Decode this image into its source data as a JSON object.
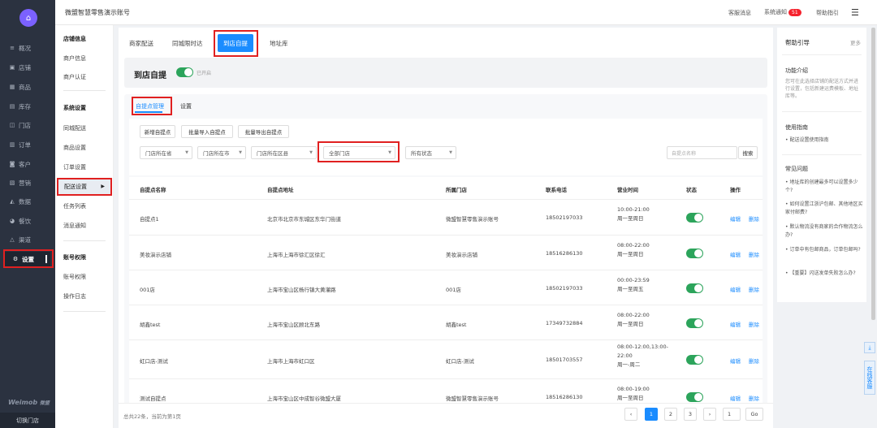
{
  "app": {
    "account_name": "微盟智慧零售演示账号",
    "brand": "Weimob",
    "brand_suffix": "微盟",
    "switch_store": "切换门店"
  },
  "topbar": {
    "service_msg": "客服消息",
    "sys_notice": "系统通知",
    "notice_count": "51",
    "help_guide": "帮助指引"
  },
  "leftnav": {
    "items": [
      {
        "label": "概况",
        "icon": "≡"
      },
      {
        "label": "店铺",
        "icon": "▣"
      },
      {
        "label": "商品",
        "icon": "▦"
      },
      {
        "label": "库存",
        "icon": "▤"
      },
      {
        "label": "门店",
        "icon": "◫"
      },
      {
        "label": "订单",
        "icon": "▥"
      },
      {
        "label": "客户",
        "icon": "◙"
      },
      {
        "label": "营销",
        "icon": "▧"
      },
      {
        "label": "数据",
        "icon": "◭"
      },
      {
        "label": "餐饮",
        "icon": "◕"
      },
      {
        "label": "渠道",
        "icon": "△"
      },
      {
        "label": "设置",
        "icon": "⚙"
      }
    ]
  },
  "subnav": {
    "store_info": "店铺信息",
    "merchant_info": "商户信息",
    "merchant_auth": "商户认证",
    "sys_settings": "系统设置",
    "same_city": "同城配送",
    "goods_settings": "商品设置",
    "order_settings": "订单设置",
    "delivery_settings": "配送设置",
    "task_list": "任务列表",
    "msg_notice": "消息通知",
    "account_perm": "账号权限",
    "account_manage": "账号权限",
    "op_log": "操作日志"
  },
  "tabs": {
    "merchant": "商家配送",
    "same_city": "同城限时达",
    "pickup": "到店自提",
    "address": "地址库"
  },
  "header": {
    "title": "到店自提",
    "status": "已开启"
  },
  "subtabs": {
    "manage": "自提点管理",
    "settings": "设置"
  },
  "toolbar": {
    "add": "新增自提点",
    "batch_import": "批量导入自提点",
    "batch_export": "批量导出自提点",
    "province": "门店所在省",
    "city": "门店所在市",
    "district": "门店所在区县",
    "all_stores": "全部门店",
    "all_status": "所有状态",
    "search_placeholder": "自提点名称",
    "search_btn": "搜索"
  },
  "table": {
    "headers": [
      "自提点名称",
      "自提点地址",
      "所属门店",
      "联系电话",
      "营业时间",
      "状态",
      "操作"
    ],
    "edit": "编辑",
    "delete": "删除",
    "rows": [
      {
        "name": "自提点1",
        "address": "北京市北京市东城区东华门街道",
        "store": "微盟智慧零售演示账号",
        "phone": "18502197033",
        "h1": "10:00-21:00",
        "h2": "周一至周日"
      },
      {
        "name": "美妆演示店铺",
        "address": "上海市上海市徐汇区徐汇",
        "store": "美妆演示店铺",
        "phone": "18516286130",
        "h1": "08:00-22:00",
        "h2": "周一至周日"
      },
      {
        "name": "001店",
        "address": "上海市宝山区杨行镇大黄灌路",
        "store": "001店",
        "phone": "18502197033",
        "h1": "00:00-23:59",
        "h2": "周一至周五"
      },
      {
        "name": "胡鑫test",
        "address": "上海市宝山区顾北东路",
        "store": "胡鑫test",
        "phone": "17349732884",
        "h1": "08:00-22:00",
        "h2": "周一至周日"
      },
      {
        "name": "虹口店-测试",
        "address": "上海市上海市虹口区",
        "store": "虹口店-测试",
        "phone": "18501703557",
        "h1": "08:00-12:00,13:00-22:00",
        "h2": "周一-周二"
      },
      {
        "name": "测试自提点",
        "address": "上海市宝山区中成智谷微盟大厦",
        "store": "微盟智慧零售演示账号",
        "phone": "18516286130",
        "h1": "08:00-19:00",
        "h2": "周一至周日"
      }
    ]
  },
  "pagination": {
    "total": "总共22条，当前为第1页",
    "p1": "1",
    "p2": "2",
    "p3": "3",
    "jump": "1",
    "go": "Go",
    "prev": "‹",
    "next": "›"
  },
  "help": {
    "title": "帮助引导",
    "more": "更多",
    "intro_title": "功能介绍",
    "intro_text": "您可在此选择店铺的配送方式并进行设置，包括新建运费模板、地址库等。",
    "guide_title": "使用指南",
    "guide_item": "• 配送设置使用指南",
    "faq_title": "常见问题",
    "faq": [
      "• 地址库的创建最多可以设置多少个?",
      "• 如何设置江浙沪包邮、其他地区买家付邮费?",
      "• 默认物流没有商家的合作物流怎么办?",
      "• 订单中有包邮商品，订单包邮吗?",
      "• 【重要】闪送发单失败怎么办?"
    ]
  },
  "float": {
    "download_icon": "⤓",
    "online_service": "在线客服"
  }
}
